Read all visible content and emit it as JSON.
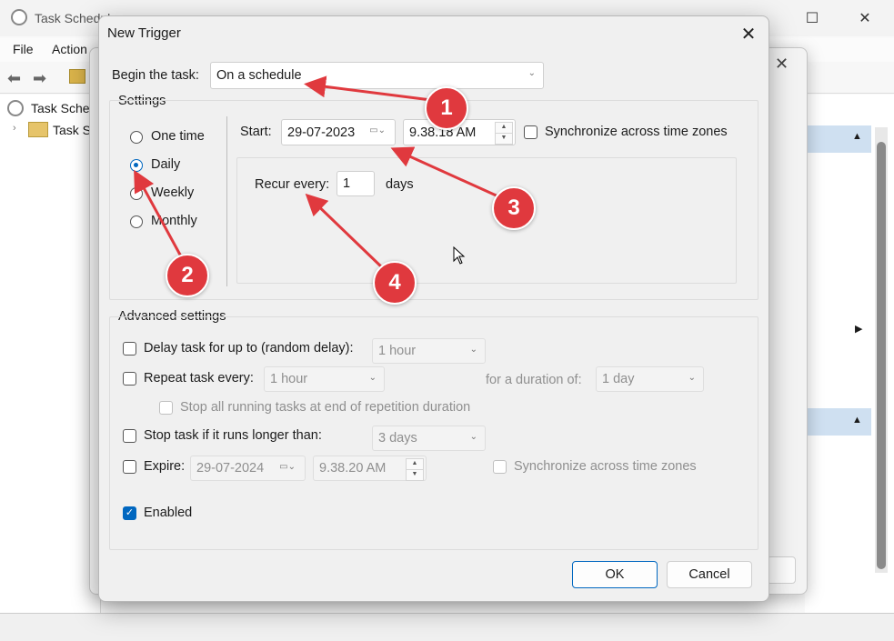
{
  "background_window": {
    "title": "Task Schedul",
    "menu": [
      "File",
      "Action"
    ],
    "tree": [
      {
        "label": "Task Scheduler"
      },
      {
        "label": "Task S"
      }
    ]
  },
  "dialog": {
    "title": "New Trigger",
    "begin_task_label": "Begin the task:",
    "begin_task_value": "On a schedule",
    "settings_label": "Settings",
    "schedule_options": [
      "One time",
      "Daily",
      "Weekly",
      "Monthly"
    ],
    "selected_option": "Daily",
    "start_label": "Start:",
    "start_date": "29-07-2023",
    "start_time": "9.38.18 AM",
    "sync_label": "Synchronize across time zones",
    "recur_label": "Recur every:",
    "recur_value": "1",
    "recur_unit": "days",
    "advanced_label": "Advanced settings",
    "delay_label": "Delay task for up to (random delay):",
    "delay_value": "1 hour",
    "repeat_label": "Repeat task every:",
    "repeat_value": "1 hour",
    "duration_label": "for a duration of:",
    "duration_value": "1 day",
    "stop_running_label": "Stop all running tasks at end of repetition duration",
    "stop_longer_label": "Stop task if it runs longer than:",
    "stop_longer_value": "3 days",
    "expire_label": "Expire:",
    "expire_date": "29-07-2024",
    "expire_time": "9.38.20 AM",
    "expire_sync_label": "Synchronize across time zones",
    "enabled_label": "Enabled",
    "enabled": true,
    "ok_label": "OK",
    "cancel_label": "Cancel"
  },
  "annotations": [
    "1",
    "2",
    "3",
    "4"
  ],
  "colors": {
    "accent": "#0067c0",
    "marker": "#e0393e"
  }
}
